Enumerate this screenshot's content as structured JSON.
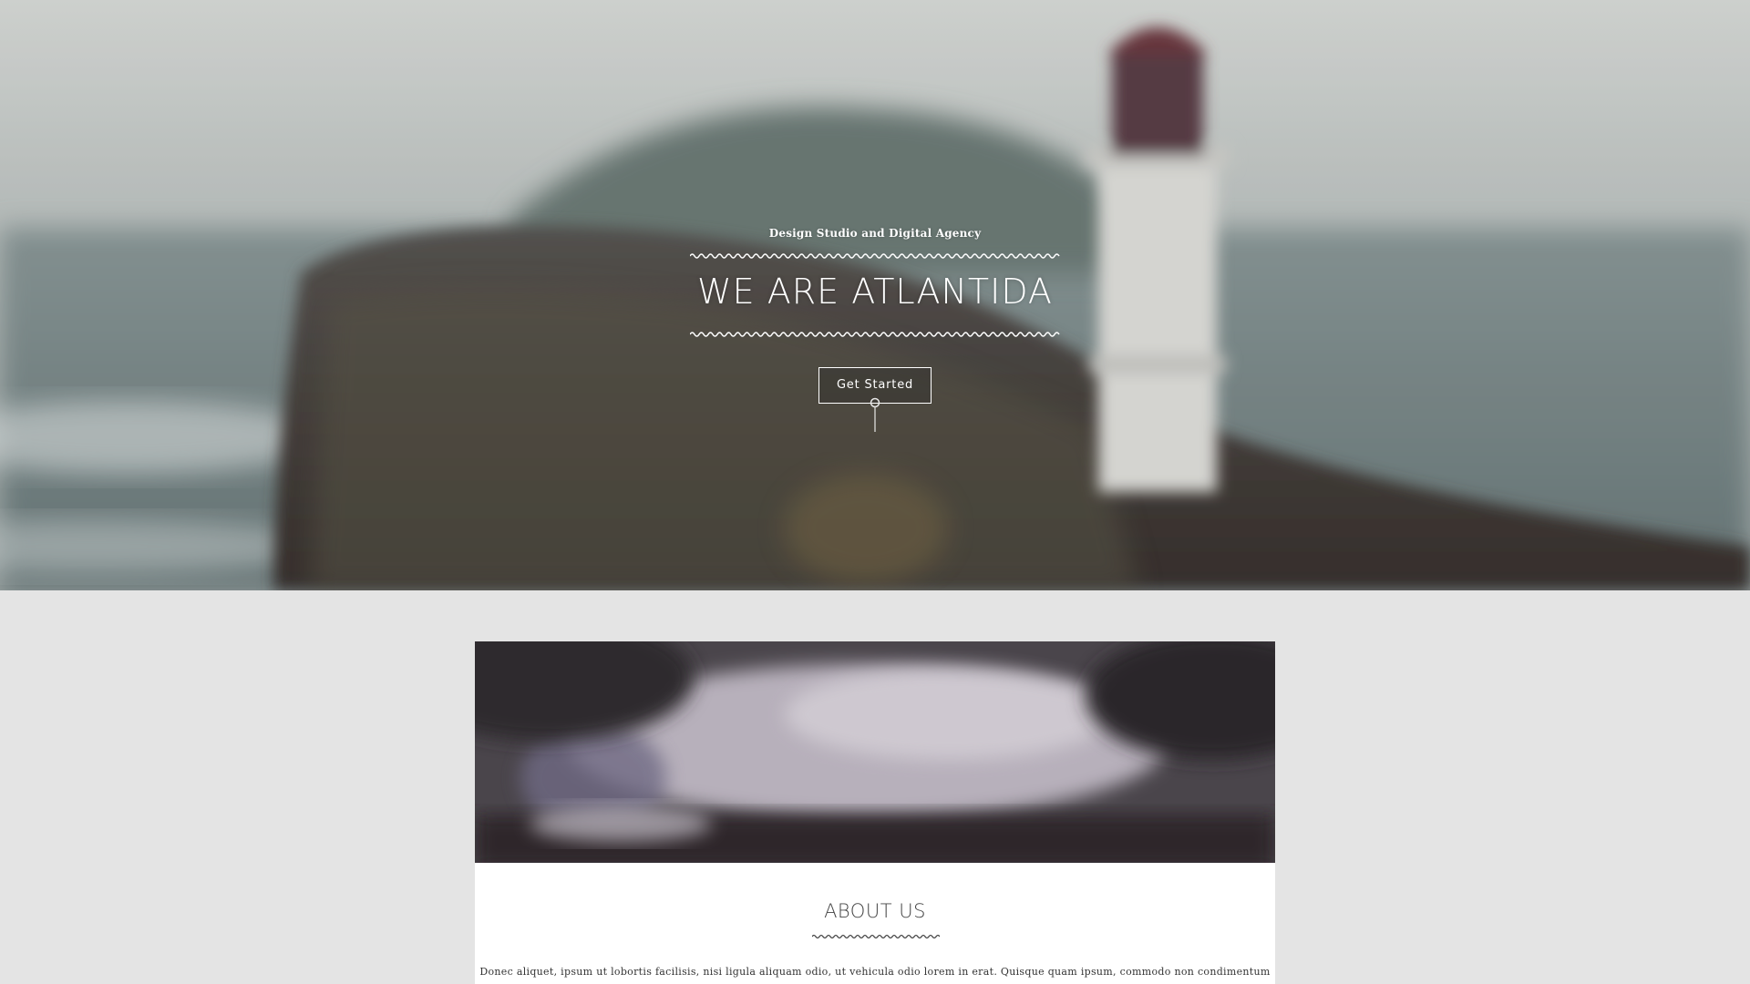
{
  "hero": {
    "tagline": "Design Studio and Digital Agency",
    "title": "WE ARE ATLANTIDA",
    "cta_label": "Get Started"
  },
  "about": {
    "title": "ABOUT US",
    "body": "Donec aliquet, ipsum ut lobortis facilisis, nisi ligula aliquam odio, ut vehicula odio lorem in erat. Quisque quam ipsum, commodo non condimentum"
  },
  "colors": {
    "page_background": "#e4e4e4",
    "card_background": "#ffffff",
    "hero_text": "#ffffff",
    "heading_text": "#444444",
    "body_text": "#333333"
  },
  "icons": {
    "scroll_indicator": "scroll-down-indicator-icon",
    "divider": "wave-divider"
  }
}
